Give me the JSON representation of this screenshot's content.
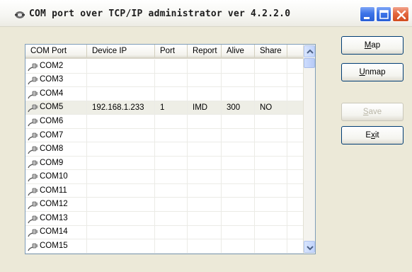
{
  "window": {
    "title": "COM port over TCP/IP administrator ver 4.2.2.0"
  },
  "list": {
    "columns": [
      "COM Port",
      "Device IP",
      "Port",
      "Report",
      "Alive",
      "Share"
    ],
    "rows": [
      {
        "com": "COM2",
        "ip": "",
        "port": "",
        "report": "",
        "alive": "",
        "share": ""
      },
      {
        "com": "COM3",
        "ip": "",
        "port": "",
        "report": "",
        "alive": "",
        "share": ""
      },
      {
        "com": "COM4",
        "ip": "",
        "port": "",
        "report": "",
        "alive": "",
        "share": ""
      },
      {
        "com": "COM5",
        "ip": "192.168.1.233",
        "port": "1",
        "report": "IMD",
        "alive": "300",
        "share": "NO",
        "selected": true
      },
      {
        "com": "COM6",
        "ip": "",
        "port": "",
        "report": "",
        "alive": "",
        "share": ""
      },
      {
        "com": "COM7",
        "ip": "",
        "port": "",
        "report": "",
        "alive": "",
        "share": ""
      },
      {
        "com": "COM8",
        "ip": "",
        "port": "",
        "report": "",
        "alive": "",
        "share": ""
      },
      {
        "com": "COM9",
        "ip": "",
        "port": "",
        "report": "",
        "alive": "",
        "share": ""
      },
      {
        "com": "COM10",
        "ip": "",
        "port": "",
        "report": "",
        "alive": "",
        "share": ""
      },
      {
        "com": "COM11",
        "ip": "",
        "port": "",
        "report": "",
        "alive": "",
        "share": ""
      },
      {
        "com": "COM12",
        "ip": "",
        "port": "",
        "report": "",
        "alive": "",
        "share": ""
      },
      {
        "com": "COM13",
        "ip": "",
        "port": "",
        "report": "",
        "alive": "",
        "share": ""
      },
      {
        "com": "COM14",
        "ip": "",
        "port": "",
        "report": "",
        "alive": "",
        "share": ""
      },
      {
        "com": "COM15",
        "ip": "",
        "port": "",
        "report": "",
        "alive": "",
        "share": ""
      }
    ],
    "row_icon": "serial-plug-icon"
  },
  "buttons": {
    "map": {
      "mnemonic": "M",
      "rest": "ap"
    },
    "unmap": {
      "mnemonic": "U",
      "rest": "nmap"
    },
    "save": {
      "mnemonic": "S",
      "rest": "ave",
      "disabled": true
    },
    "exit": {
      "pre": "E",
      "mnemonic": "x",
      "rest": "it"
    }
  },
  "colors": {
    "selected_row": "#eeeee6",
    "title_blue_button": "#3c74e8",
    "close_button": "#e4683f",
    "list_border": "#7f9db9"
  }
}
